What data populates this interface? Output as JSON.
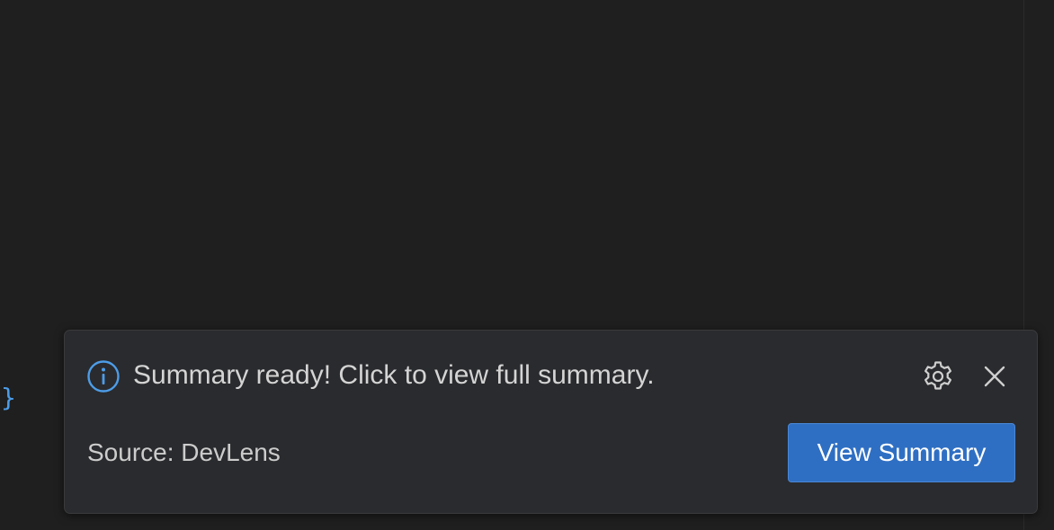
{
  "editor": {
    "visible_code": "}"
  },
  "notification": {
    "type_icon": "info-icon",
    "message": "Summary ready! Click to view full summary.",
    "source_text": "Source: DevLens",
    "settings_icon": "gear-icon",
    "close_icon": "close-icon",
    "action_button_label": "View Summary"
  },
  "colors": {
    "accent": "#2f6fc3",
    "info_icon": "#4d9de8",
    "background": "#1f1f1f",
    "toast_background": "#2a2b2e"
  }
}
